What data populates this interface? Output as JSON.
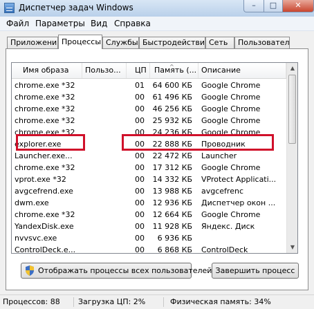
{
  "window": {
    "title": "Диспетчер задач Windows",
    "minimize_glyph": "–",
    "maximize_glyph": "□",
    "close_glyph": "✕"
  },
  "menu": [
    "Файл",
    "Параметры",
    "Вид",
    "Справка"
  ],
  "tabs": [
    "Приложения",
    "Процессы",
    "Службы",
    "Быстродействие",
    "Сеть",
    "Пользователи"
  ],
  "active_tab": "Процессы",
  "columns": [
    "Имя образа",
    "Пользо...",
    "ЦП",
    "Память (...",
    "Описание"
  ],
  "sort_glyph": "^",
  "processes": [
    {
      "name": "chrome.exe *32",
      "user": "",
      "cpu": "01",
      "memory": "64 600 КБ",
      "description": "Google Chrome"
    },
    {
      "name": "chrome.exe *32",
      "user": "",
      "cpu": "00",
      "memory": "61 496 КБ",
      "description": "Google Chrome"
    },
    {
      "name": "chrome.exe *32",
      "user": "",
      "cpu": "00",
      "memory": "46 256 КБ",
      "description": "Google Chrome"
    },
    {
      "name": "chrome.exe *32",
      "user": "",
      "cpu": "00",
      "memory": "25 932 КБ",
      "description": "Google Chrome"
    },
    {
      "name": "chrome.exe *32",
      "user": "",
      "cpu": "00",
      "memory": "24 236 КБ",
      "description": "Google Chrome"
    },
    {
      "name": "explorer.exe",
      "user": "",
      "cpu": "00",
      "memory": "22 888 КБ",
      "description": "Проводник"
    },
    {
      "name": "Launcher.exe...",
      "user": "",
      "cpu": "00",
      "memory": "22 472 КБ",
      "description": "Launcher"
    },
    {
      "name": "chrome.exe *32",
      "user": "",
      "cpu": "00",
      "memory": "17 312 КБ",
      "description": "Google Chrome"
    },
    {
      "name": "vprot.exe *32",
      "user": "",
      "cpu": "00",
      "memory": "14 332 КБ",
      "description": "VProtect Applicati..."
    },
    {
      "name": "avgcefrend.exe",
      "user": "",
      "cpu": "00",
      "memory": "13 988 КБ",
      "description": "avgcefrenc"
    },
    {
      "name": "dwm.exe",
      "user": "",
      "cpu": "00",
      "memory": "12 936 КБ",
      "description": "Диспетчер окон ..."
    },
    {
      "name": "chrome.exe *32",
      "user": "",
      "cpu": "00",
      "memory": "12 664 КБ",
      "description": "Google Chrome"
    },
    {
      "name": "YandexDisk.exe",
      "user": "",
      "cpu": "00",
      "memory": "11 928 КБ",
      "description": "Яндекс. Диск"
    },
    {
      "name": "nvvsvc.exe",
      "user": "",
      "cpu": "00",
      "memory": "6 936 КБ",
      "description": ""
    },
    {
      "name": "ControlDeck.e...",
      "user": "",
      "cpu": "00",
      "memory": "6 868 КБ",
      "description": "ControlDeck"
    }
  ],
  "selected_row": "explorer.exe",
  "highlight_color": "#d0102a",
  "buttons": {
    "show_all": "Отображать процессы всех пользователей",
    "end_process": "Завершить процесс"
  },
  "status": {
    "processes": "Процессов: 88",
    "cpu": "Загрузка ЦП: 2%",
    "memory": "Физическая память: 34%"
  }
}
